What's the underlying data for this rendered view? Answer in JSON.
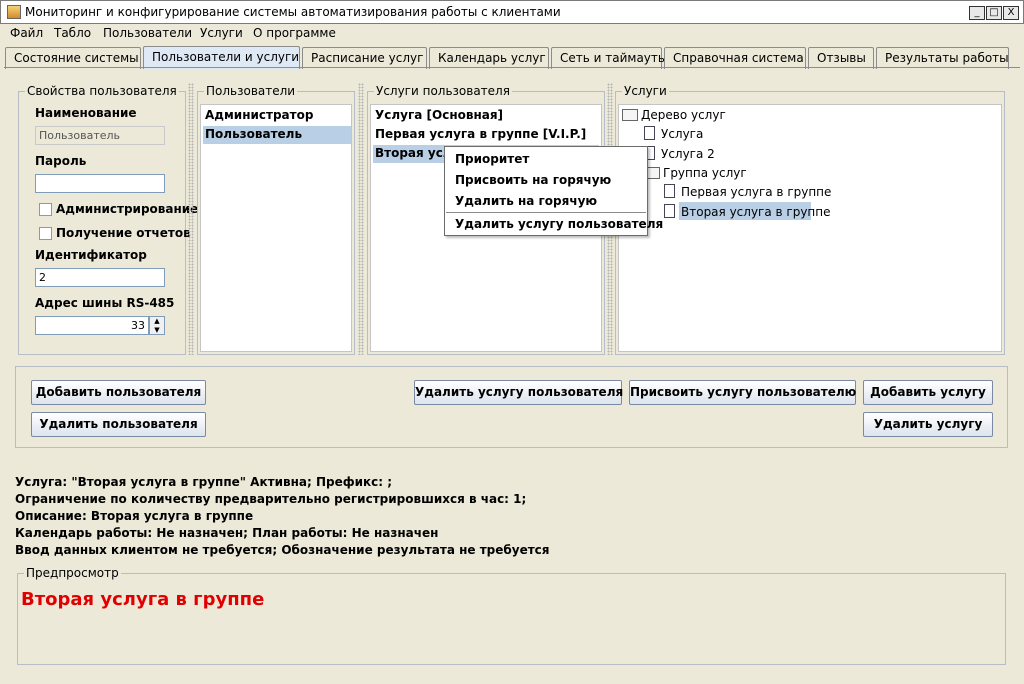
{
  "window": {
    "title": "Мониторинг и конфигурирование системы автоматизирования работы с клиентами",
    "minimize": "_",
    "maximize": "□",
    "close": "X"
  },
  "menu": [
    "Файл",
    "Табло",
    "Пользователи",
    "Услуги",
    "О программе"
  ],
  "tabs": [
    "Состояние системы",
    "Пользователи и услуги",
    "Расписание услуг",
    "Календарь услуг",
    "Сеть и таймауты",
    "Справочная система",
    "Отзывы",
    "Результаты работы"
  ],
  "user_props": {
    "title": "Свойства пользователя",
    "name_label": "Наименование",
    "name_value": "Пользователь",
    "password_label": "Пароль",
    "password_value": "",
    "admin_label": "Администрирование",
    "reports_label": "Получение отчетов",
    "id_label": "Идентификатор",
    "id_value": "2",
    "bus_label": "Адрес шины RS-485",
    "bus_value": "33"
  },
  "users": {
    "title": "Пользователи",
    "items": [
      "Администратор",
      "Пользователь"
    ]
  },
  "user_services": {
    "title": "Услуги пользователя",
    "items": [
      "Услуга [Основная]",
      "Первая услуга в группе [V.I.P.]",
      "Вторая услуга в группе"
    ]
  },
  "services": {
    "title": "Услуги",
    "tree": [
      "Дерево услуг",
      "Услуга",
      "Услуга 2",
      "Группа услуг",
      "Первая услуга в группе",
      "Вторая услуга в группе"
    ]
  },
  "context_menu": [
    "Приоритет",
    "Присвоить на горячую",
    "Удалить на горячую",
    "Удалить услугу пользователя"
  ],
  "buttons": {
    "add_user": "Добавить пользователя",
    "delete_user": "Удалить пользователя",
    "delete_user_service": "Удалить услугу пользователя",
    "assign_service": "Присвоить услугу пользователю",
    "add_service": "Добавить услугу",
    "delete_service": "Удалить услугу"
  },
  "info": [
    "Услуга: \"Вторая услуга в группе\" Активна; Префикс: ;",
    "Ограничение по количеству предварительно регистрировшихся в час: 1;",
    "Описание: Вторая услуга в группе",
    "Календарь работы: Не назначен; План работы: Не назначен",
    "Ввод данных клиентом не требуется; Обозначение результата не требуется"
  ],
  "preview": {
    "title": "Предпросмотр",
    "text": "Вторая услуга в группе",
    "color": "#e00000"
  }
}
